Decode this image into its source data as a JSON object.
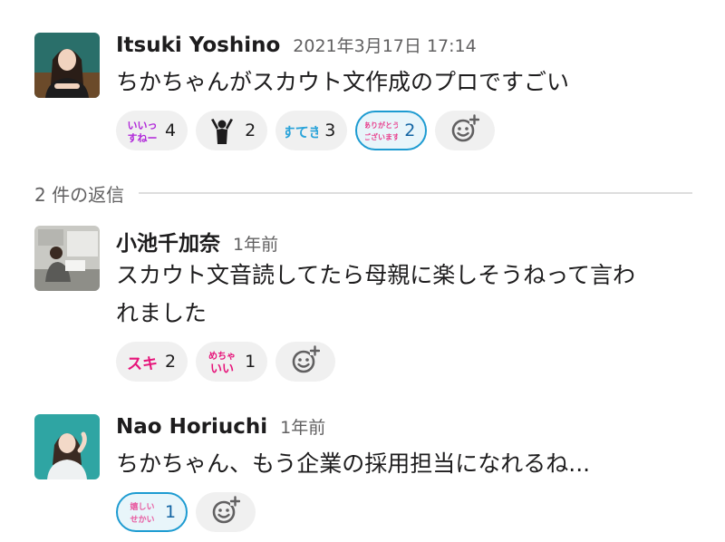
{
  "parent_message": {
    "sender": "Itsuki Yoshino",
    "timestamp": "2021年3月17日 17:14",
    "text": "ちかちゃんがスカウト文作成のプロですごい",
    "reactions": [
      {
        "emoji": "iine-suneeee-emoji",
        "label": "いいっすねー",
        "count": "4",
        "own": false
      },
      {
        "emoji": "person-raising-arms-emoji",
        "count": "2",
        "own": false
      },
      {
        "emoji": "suteki-emoji",
        "label": "すてき",
        "count": "3",
        "own": false
      },
      {
        "emoji": "arigatou-gozaimasu-emoji",
        "label": "ありがとうございます",
        "count": "2",
        "own": true
      }
    ]
  },
  "thread": {
    "reply_count_label": "2 件の返信"
  },
  "replies": [
    {
      "sender": "小池千加奈",
      "timestamp": "1年前",
      "text_line1": "スカウト文音読してたら母親に楽しそうねって言わ",
      "text_line2": "れました",
      "reactions": [
        {
          "emoji": "suki-emoji",
          "label": "スキ",
          "count": "2",
          "own": false
        },
        {
          "emoji": "mecha-iii-emoji",
          "label": "めちゃいい",
          "count": "1",
          "own": false
        }
      ]
    },
    {
      "sender": "Nao Horiuchi",
      "timestamp": "1年前",
      "text": "ちかちゃん、もう企業の採用担当になれるね...",
      "reactions": [
        {
          "emoji": "ureshii-sekai-emoji",
          "label": "嬉しいせかい",
          "count": "1",
          "own": true
        }
      ]
    }
  ],
  "colors": {
    "own_reaction_border": "#1d9bd1",
    "own_reaction_bg": "#e8f5fa",
    "reaction_bg": "#f0f0f0",
    "muted_text": "#616061",
    "avatar1_bg": "#2a6f6a",
    "avatar3_bg": "#2fa5a3"
  },
  "icons": {
    "add_reaction": "add-reaction-icon"
  }
}
